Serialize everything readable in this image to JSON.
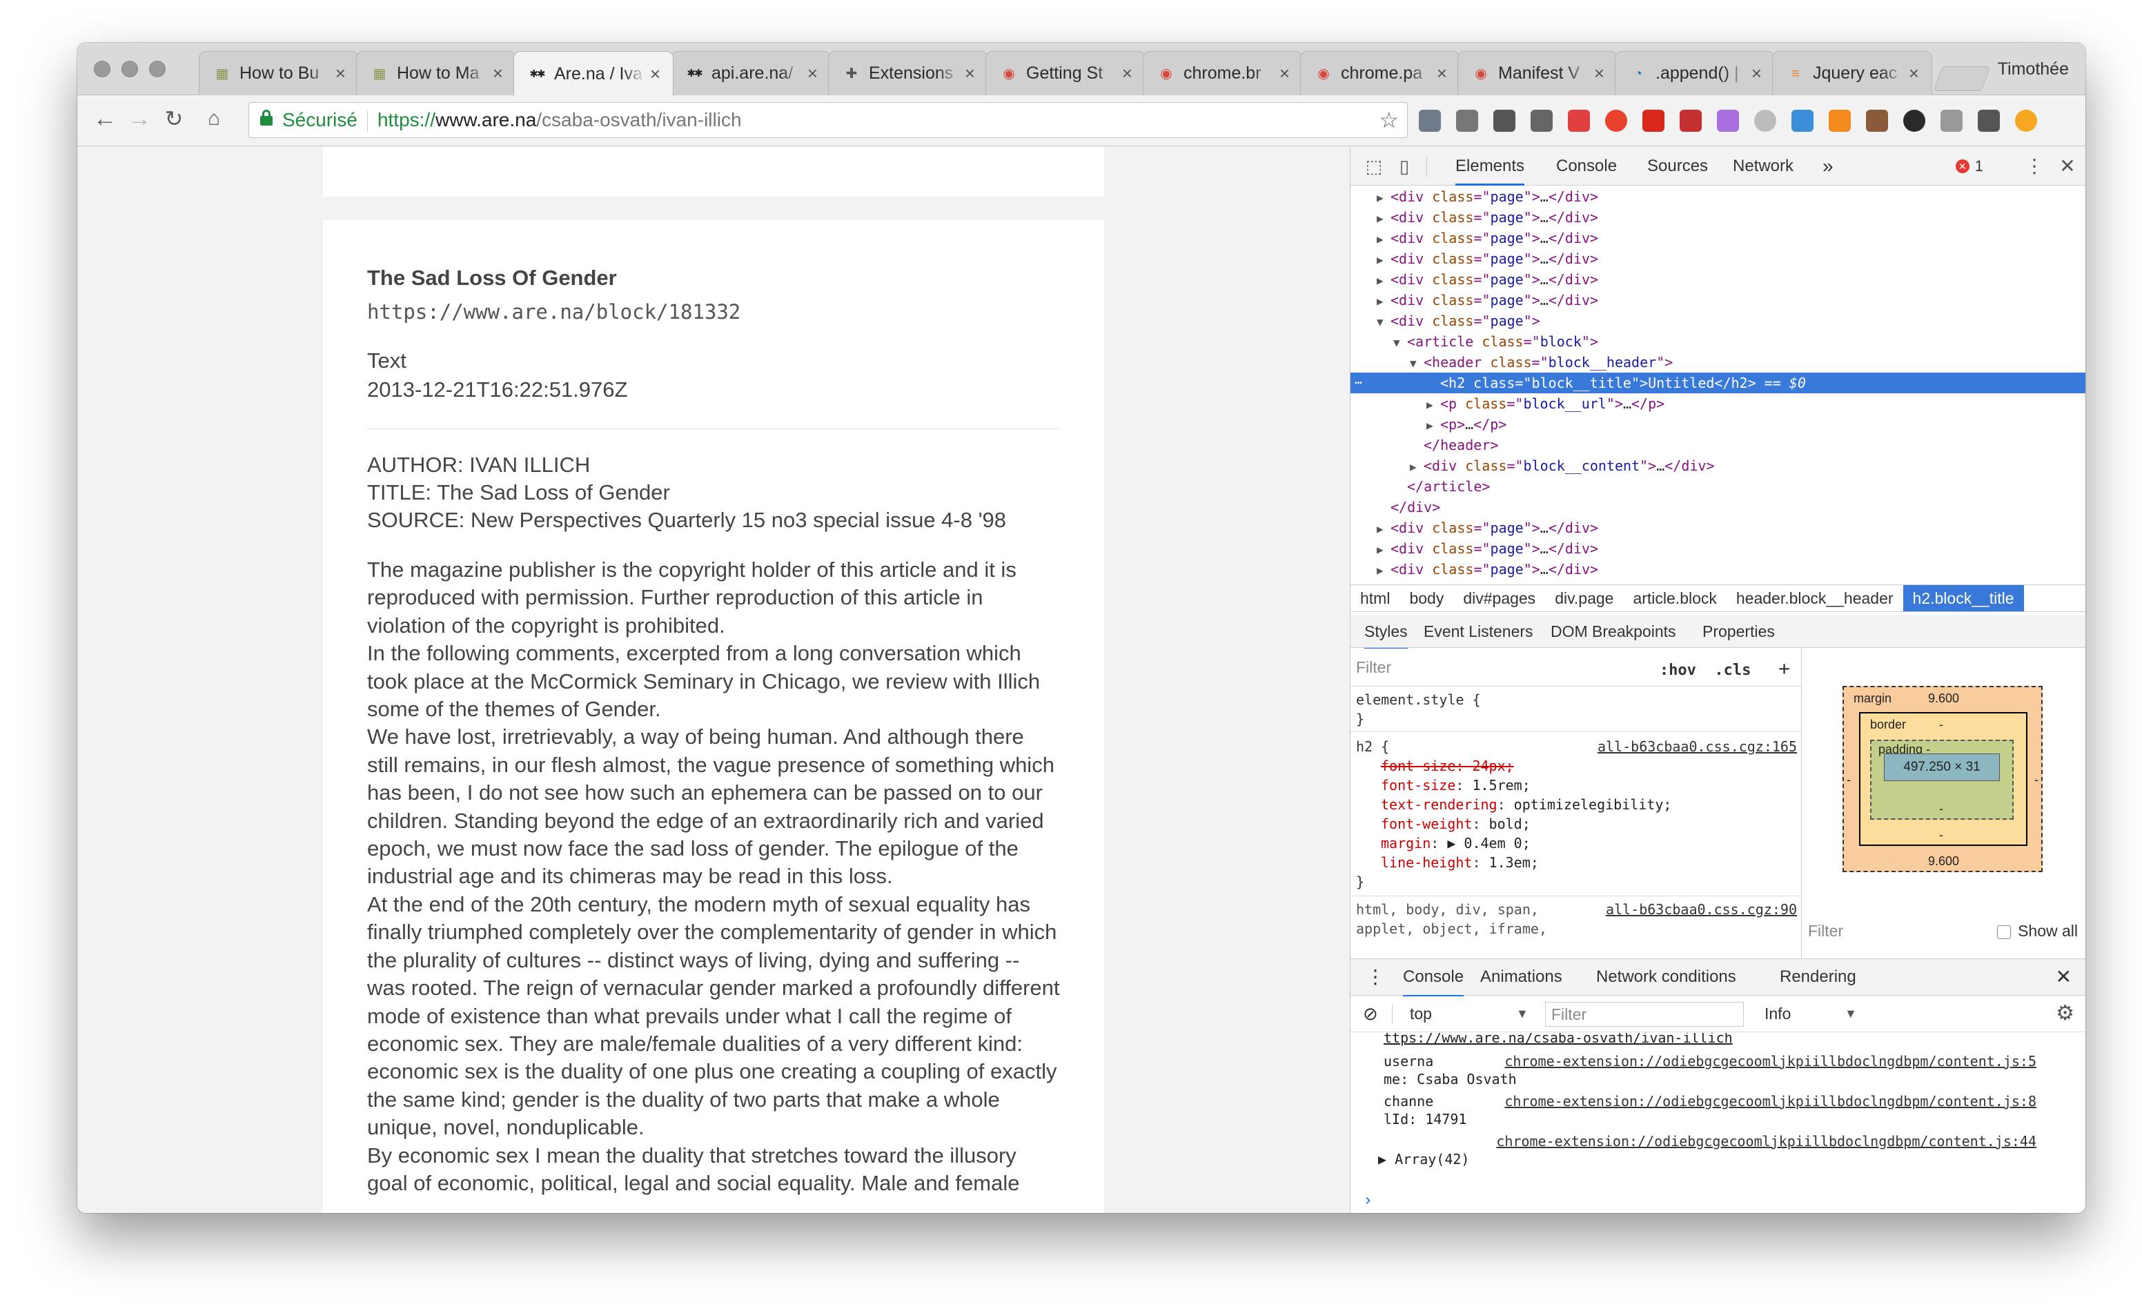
{
  "window": {
    "profile_name": "Timothée",
    "traffic_light_color": "#9a9a9a"
  },
  "tabs": [
    {
      "label": "How to Bu",
      "icon": "document-icon",
      "active": false
    },
    {
      "label": "How to Ma",
      "icon": "document-icon",
      "active": false
    },
    {
      "label": "Are.na / Iva",
      "icon": "arena-icon",
      "active": true
    },
    {
      "label": "api.are.na/",
      "icon": "arena-icon",
      "active": false
    },
    {
      "label": "Extensions",
      "icon": "puzzle-icon",
      "active": false
    },
    {
      "label": "Getting St",
      "icon": "chrome-icon",
      "active": false
    },
    {
      "label": "chrome.br",
      "icon": "chrome-icon",
      "active": false
    },
    {
      "label": "chrome.pa",
      "icon": "chrome-icon",
      "active": false
    },
    {
      "label": "Manifest V",
      "icon": "chrome-icon",
      "active": false
    },
    {
      "label": ".append() |",
      "icon": "jquery-icon",
      "active": false
    },
    {
      "label": "Jquery eac",
      "icon": "stackoverflow-icon",
      "active": false
    }
  ],
  "toolbar": {
    "secure_label": "Sécurisé",
    "url_scheme": "https://",
    "url_host": "www.are.na",
    "url_path": "/csaba-osvath/ivan-illich",
    "accent": "#1e8e3e"
  },
  "extensions": [
    {
      "icon": "key-icon",
      "color": "#6d7a8a"
    },
    {
      "icon": "cast-icon",
      "color": "#777777"
    },
    {
      "icon": "info-icon",
      "color": "#555555"
    },
    {
      "icon": "lightbulb-icon",
      "color": "#666666"
    },
    {
      "icon": "puzzle-red-icon",
      "color": "#e04040"
    },
    {
      "icon": "adblock-icon",
      "color": "#e8412c"
    },
    {
      "icon": "abp-icon",
      "color": "#d8271b"
    },
    {
      "icon": "shield-icon",
      "color": "#c43030"
    },
    {
      "icon": "feather-icon",
      "color": "#a86ee0"
    },
    {
      "icon": "ring-icon",
      "color": "#bbbbbb"
    },
    {
      "icon": "hand-icon",
      "color": "#3a8fd8"
    },
    {
      "icon": "b-icon",
      "color": "#f28a1c"
    },
    {
      "icon": "face-icon",
      "color": "#8a5a3a"
    },
    {
      "icon": "circle-icon",
      "color": "#2a2a2a"
    },
    {
      "icon": "camera-icon",
      "color": "#999999"
    },
    {
      "icon": "print-icon",
      "color": "#555555"
    },
    {
      "icon": "alert-icon",
      "color": "#f5a623"
    }
  ],
  "block": {
    "title": "The Sad Loss Of Gender",
    "url": "https://www.are.na/block/181332",
    "type": "Text",
    "date": "2013-12-21T16:22:51.976Z",
    "meta": [
      "AUTHOR: IVAN ILLICH",
      "TITLE: The Sad Loss of Gender",
      "SOURCE: New Perspectives Quarterly 15 no3 special issue 4-8 '98"
    ],
    "paragraphs": [
      "The magazine publisher is the copyright holder of this article and it is reproduced with permission. Further reproduction of this article in violation of the copyright is prohibited.",
      "In the following comments, excerpted from a long conversation which took place at the McCormick Seminary in Chicago, we review with Illich some of the themes of Gender.",
      "We have lost, irretrievably, a way of being human. And although there still remains, in our flesh almost, the vague presence of something which has been, I do not see how such an ephemera can be passed on to our children. Standing beyond the edge of an extraordinarily rich and varied epoch, we must now face the sad loss of gender. The epilogue of the industrial age and its chimeras may be read in this loss.",
      "At the end of the 20th century, the modern myth of sexual equality has finally triumphed completely over the complementarity of gender in which the plurality of cultures -- distinct ways of living, dying and suffering -- was rooted. The reign of vernacular gender marked a profoundly different mode of existence than what prevails under what I call the regime of economic sex. They are male/female dualities of a very different kind: economic sex is the duality of one plus one creating a coupling of exactly the same kind; gender is the duality of two parts that make a whole unique, novel, nonduplicable.",
      "By economic sex I mean the duality that stretches toward the illusory goal of economic, political, legal and social equality. Male and female"
    ]
  },
  "devtools": {
    "tabs": [
      "Elements",
      "Console",
      "Sources",
      "Network"
    ],
    "more_tabs": "»",
    "error_count": "1",
    "dom_lines": [
      {
        "indent": 1,
        "arrow": "▶",
        "parts": [
          [
            "tg",
            "<div "
          ],
          [
            "an",
            "class"
          ],
          [
            "tg",
            "=\""
          ],
          [
            "av",
            "page"
          ],
          [
            "tg",
            "\">"
          ],
          [
            "txt",
            "…"
          ],
          [
            "tg",
            "</div>"
          ]
        ]
      },
      {
        "indent": 1,
        "arrow": "▶",
        "parts": [
          [
            "tg",
            "<div "
          ],
          [
            "an",
            "class"
          ],
          [
            "tg",
            "=\""
          ],
          [
            "av",
            "page"
          ],
          [
            "tg",
            "\">"
          ],
          [
            "txt",
            "…"
          ],
          [
            "tg",
            "</div>"
          ]
        ]
      },
      {
        "indent": 1,
        "arrow": "▶",
        "parts": [
          [
            "tg",
            "<div "
          ],
          [
            "an",
            "class"
          ],
          [
            "tg",
            "=\""
          ],
          [
            "av",
            "page"
          ],
          [
            "tg",
            "\">"
          ],
          [
            "txt",
            "…"
          ],
          [
            "tg",
            "</div>"
          ]
        ]
      },
      {
        "indent": 1,
        "arrow": "▶",
        "parts": [
          [
            "tg",
            "<div "
          ],
          [
            "an",
            "class"
          ],
          [
            "tg",
            "=\""
          ],
          [
            "av",
            "page"
          ],
          [
            "tg",
            "\">"
          ],
          [
            "txt",
            "…"
          ],
          [
            "tg",
            "</div>"
          ]
        ]
      },
      {
        "indent": 1,
        "arrow": "▶",
        "parts": [
          [
            "tg",
            "<div "
          ],
          [
            "an",
            "class"
          ],
          [
            "tg",
            "=\""
          ],
          [
            "av",
            "page"
          ],
          [
            "tg",
            "\">"
          ],
          [
            "txt",
            "…"
          ],
          [
            "tg",
            "</div>"
          ]
        ]
      },
      {
        "indent": 1,
        "arrow": "▶",
        "parts": [
          [
            "tg",
            "<div "
          ],
          [
            "an",
            "class"
          ],
          [
            "tg",
            "=\""
          ],
          [
            "av",
            "page"
          ],
          [
            "tg",
            "\">"
          ],
          [
            "txt",
            "…"
          ],
          [
            "tg",
            "</div>"
          ]
        ]
      },
      {
        "indent": 1,
        "arrow": "▼",
        "parts": [
          [
            "tg",
            "<div "
          ],
          [
            "an",
            "class"
          ],
          [
            "tg",
            "=\""
          ],
          [
            "av",
            "page"
          ],
          [
            "tg",
            "\">"
          ]
        ]
      },
      {
        "indent": 2,
        "arrow": "▼",
        "parts": [
          [
            "tg",
            "<article "
          ],
          [
            "an",
            "class"
          ],
          [
            "tg",
            "=\""
          ],
          [
            "av",
            "block"
          ],
          [
            "tg",
            "\">"
          ]
        ]
      },
      {
        "indent": 3,
        "arrow": "▼",
        "parts": [
          [
            "tg",
            "<header "
          ],
          [
            "an",
            "class"
          ],
          [
            "tg",
            "=\""
          ],
          [
            "av",
            "block__header"
          ],
          [
            "tg",
            "\">"
          ]
        ]
      },
      {
        "indent": 4,
        "arrow": "",
        "selected": true,
        "parts": [
          [
            "tg",
            "<h2 "
          ],
          [
            "an",
            "class"
          ],
          [
            "tg",
            "=\""
          ],
          [
            "av",
            "block__title"
          ],
          [
            "tg",
            "\">"
          ],
          [
            "txt",
            "Untitled"
          ],
          [
            "tg",
            "</h2>"
          ],
          [
            "txt",
            " == $0"
          ]
        ]
      },
      {
        "indent": 4,
        "arrow": "▶",
        "parts": [
          [
            "tg",
            "<p "
          ],
          [
            "an",
            "class"
          ],
          [
            "tg",
            "=\""
          ],
          [
            "av",
            "block__url"
          ],
          [
            "tg",
            "\">"
          ],
          [
            "txt",
            "…"
          ],
          [
            "tg",
            "</p>"
          ]
        ]
      },
      {
        "indent": 4,
        "arrow": "▶",
        "parts": [
          [
            "tg",
            "<p>"
          ],
          [
            "txt",
            "…"
          ],
          [
            "tg",
            "</p>"
          ]
        ]
      },
      {
        "indent": 3,
        "arrow": "",
        "parts": [
          [
            "tg",
            "</header>"
          ]
        ]
      },
      {
        "indent": 3,
        "arrow": "▶",
        "parts": [
          [
            "tg",
            "<div "
          ],
          [
            "an",
            "class"
          ],
          [
            "tg",
            "=\""
          ],
          [
            "av",
            "block__content"
          ],
          [
            "tg",
            "\">"
          ],
          [
            "txt",
            "…"
          ],
          [
            "tg",
            "</div>"
          ]
        ]
      },
      {
        "indent": 2,
        "arrow": "",
        "parts": [
          [
            "tg",
            "</article>"
          ]
        ]
      },
      {
        "indent": 1,
        "arrow": "",
        "parts": [
          [
            "tg",
            "</div>"
          ]
        ]
      },
      {
        "indent": 1,
        "arrow": "▶",
        "parts": [
          [
            "tg",
            "<div "
          ],
          [
            "an",
            "class"
          ],
          [
            "tg",
            "=\""
          ],
          [
            "av",
            "page"
          ],
          [
            "tg",
            "\">"
          ],
          [
            "txt",
            "…"
          ],
          [
            "tg",
            "</div>"
          ]
        ]
      },
      {
        "indent": 1,
        "arrow": "▶",
        "parts": [
          [
            "tg",
            "<div "
          ],
          [
            "an",
            "class"
          ],
          [
            "tg",
            "=\""
          ],
          [
            "av",
            "page"
          ],
          [
            "tg",
            "\">"
          ],
          [
            "txt",
            "…"
          ],
          [
            "tg",
            "</div>"
          ]
        ]
      },
      {
        "indent": 1,
        "arrow": "▶",
        "parts": [
          [
            "tg",
            "<div "
          ],
          [
            "an",
            "class"
          ],
          [
            "tg",
            "=\""
          ],
          [
            "av",
            "page"
          ],
          [
            "tg",
            "\">"
          ],
          [
            "txt",
            "…"
          ],
          [
            "tg",
            "</div>"
          ]
        ]
      }
    ],
    "dom_ellipsis": "…",
    "breadcrumbs": [
      "html",
      "body",
      "div#pages",
      "div.page",
      "article.block",
      "header.block__header",
      "h2.block__title"
    ],
    "styles_tabs": [
      "Styles",
      "Event Listeners",
      "DOM Breakpoints",
      "Properties"
    ],
    "styles": {
      "filter_placeholder": "Filter",
      "hov": ":hov",
      "cls": ".cls",
      "plus": "+",
      "element_style": "element.style {",
      "close_brace": "}",
      "h2_selector": "h2 {",
      "h2_source": "all-b63cbaa0.css.cgz:165",
      "declarations": [
        {
          "prop": "font-size",
          "value": "24px;",
          "struck": true
        },
        {
          "prop": "font-size",
          "value": "1.5rem;",
          "struck": false
        },
        {
          "prop": "text-rendering",
          "value": "optimizelegibility;",
          "struck": false
        },
        {
          "prop": "font-weight",
          "value": "bold;",
          "struck": false
        },
        {
          "prop": "margin",
          "value": "▶ 0.4em 0;",
          "struck": false
        },
        {
          "prop": "line-height",
          "value": "1.3em;",
          "struck": false
        }
      ],
      "inherited_1": "html, body, div, span,",
      "inherited_source": "all-b63cbaa0.css.cgz:90",
      "inherited_2": "applet, object, iframe,"
    },
    "box_model": {
      "margin_label": "margin",
      "margin_top": "9.600",
      "margin_bottom": "9.600",
      "margin_side": "-",
      "border_label": "border",
      "border_value": "-",
      "padding_label": "padding -",
      "padding_value": "-",
      "content_size": "497.250 × 31",
      "filter_label": "Filter",
      "show_all": "Show all"
    },
    "drawer_tabs": [
      "Console",
      "Animations",
      "Network conditions",
      "Rendering"
    ],
    "console_toolbar": {
      "context": "top",
      "filter_placeholder": "Filter",
      "level": "Info"
    },
    "console_lines": [
      {
        "text": "ttps://www.are.na/csaba-osvath/ivan-illich",
        "link": "",
        "link_style": "underline"
      },
      {
        "text": "userna",
        "link": "chrome-extension://odiebgcgecoomljkpiillbdoclngdbpm/content.js:5"
      },
      {
        "text": "me: Csaba Osvath",
        "link": ""
      },
      {
        "text": "channe",
        "link": "chrome-extension://odiebgcgecoomljkpiillbdoclngdbpm/content.js:8"
      },
      {
        "text": "lId: 14791",
        "link": ""
      },
      {
        "text": "",
        "link": "chrome-extension://odiebgcgecoomljkpiillbdoclngdbpm/content.js:44"
      },
      {
        "text": "▶ Array(42)",
        "link": ""
      }
    ],
    "prompt": "›"
  }
}
